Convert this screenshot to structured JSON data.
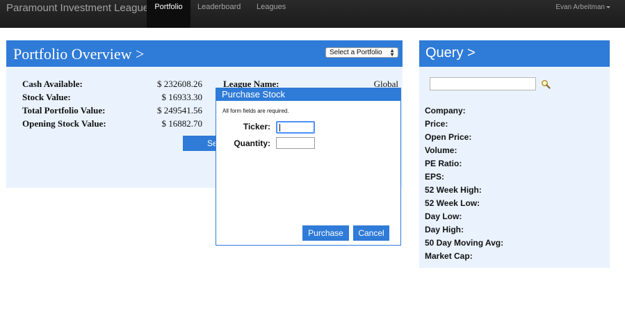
{
  "navbar": {
    "brand": "Paramount Investment League",
    "items": [
      {
        "label": "Portfolio",
        "active": true
      },
      {
        "label": "Leaderboard",
        "active": false
      },
      {
        "label": "Leagues",
        "active": false
      }
    ],
    "user": "Evan Arbeitman"
  },
  "portfolio": {
    "title": "Portfolio Overview >",
    "select_label": "Select a Portfolio",
    "stats": [
      {
        "label": "Cash Available:",
        "value": "$ 232608.26"
      },
      {
        "label": "Stock Value:",
        "value": "$ 16933.30"
      },
      {
        "label": "Total Portfolio Value:",
        "value": "$ 249541.56"
      },
      {
        "label": "Opening Stock Value:",
        "value": "$ 16882.70"
      }
    ],
    "league_label": "League Name:",
    "league_value": "Global",
    "partial_button_text": "Se"
  },
  "query": {
    "title": "Query >",
    "search_value": "",
    "fields": [
      "Company:",
      "Price:",
      "Open Price:",
      "Volume:",
      "PE Ratio:",
      "EPS:",
      "52 Week High:",
      "52 Week Low:",
      "Day Low:",
      "Day High:",
      "50 Day Moving Avg:",
      "Market Cap:"
    ]
  },
  "modal": {
    "title": "Purchase Stock",
    "note": "All form fields are required.",
    "ticker_label": "Ticker:",
    "ticker_value": "",
    "quantity_label": "Quantity:",
    "quantity_value": "",
    "purchase_label": "Purchase",
    "cancel_label": "Cancel"
  },
  "colors": {
    "accent": "#2f7bd8",
    "panel_bg": "#eaf3fd",
    "navbar_bg": "#1b1b1b"
  },
  "icons": {
    "search": "search-icon",
    "dropdown": "caret-down-icon"
  }
}
